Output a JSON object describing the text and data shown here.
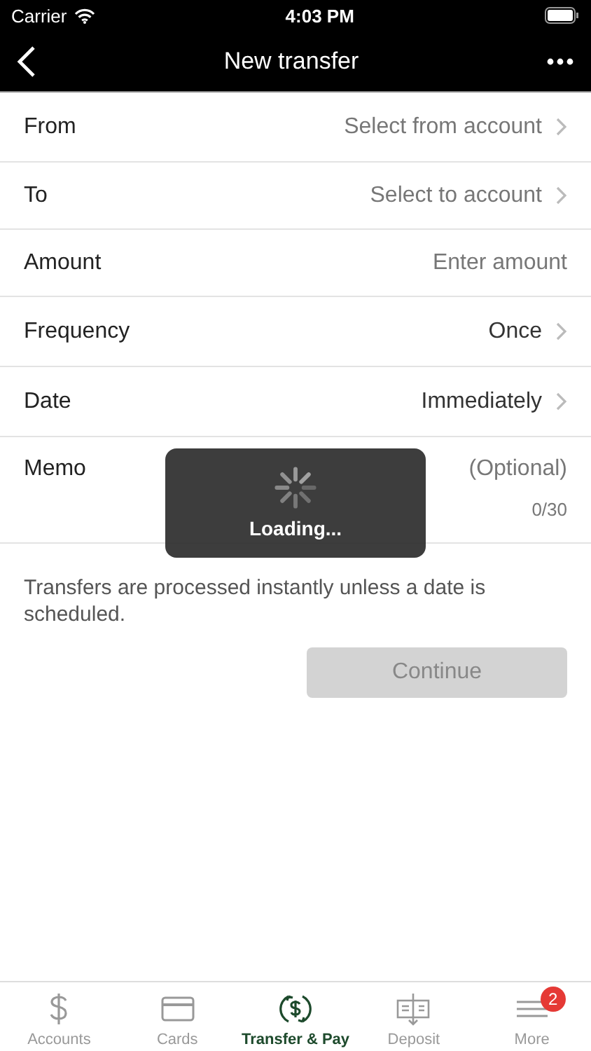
{
  "status_bar": {
    "carrier": "Carrier",
    "time": "4:03 PM"
  },
  "nav_bar": {
    "title": "New transfer"
  },
  "form": [
    {
      "kind": "select",
      "label": "From",
      "placeholder": "Select from account"
    },
    {
      "kind": "select",
      "label": "To",
      "placeholder": "Select to account"
    },
    {
      "kind": "input",
      "label": "Amount",
      "placeholder": "Enter amount"
    },
    {
      "kind": "select",
      "label": "Frequency",
      "value": "Once"
    },
    {
      "kind": "select",
      "label": "Date",
      "value": "Immediately"
    },
    {
      "kind": "memo",
      "label": "Memo",
      "placeholder": "(Optional)",
      "counter": "0/30"
    }
  ],
  "note": "Transfers are processed instantly unless a date is scheduled.",
  "continue_button": {
    "label": "Continue",
    "disabled": true
  },
  "loading": {
    "label": "Loading..."
  },
  "tab_bar": [
    {
      "kind": "dollar",
      "label": "Accounts",
      "selected": false
    },
    {
      "kind": "card",
      "label": "Cards",
      "selected": false
    },
    {
      "kind": "transfer",
      "label": "Transfer & Pay",
      "selected": true
    },
    {
      "kind": "deposit",
      "label": "Deposit",
      "selected": false
    },
    {
      "kind": "menu",
      "label": "More",
      "selected": false,
      "badge": "2"
    }
  ]
}
